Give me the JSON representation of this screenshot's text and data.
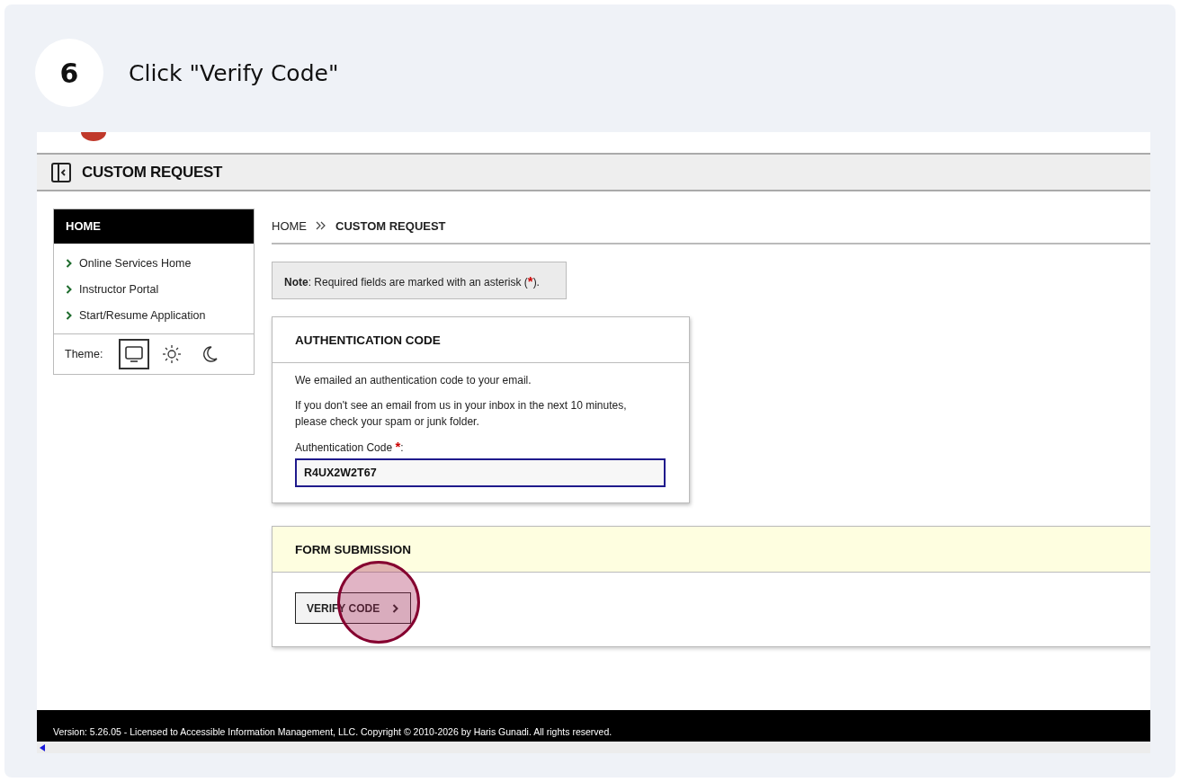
{
  "step": {
    "number": "6",
    "title": "Click \"Verify Code\""
  },
  "header": {
    "title": "CUSTOM REQUEST"
  },
  "sidebar": {
    "title": "HOME",
    "items": [
      {
        "label": "Online Services Home"
      },
      {
        "label": "Instructor Portal"
      },
      {
        "label": "Start/Resume Application"
      }
    ],
    "theme_label": "Theme:",
    "theme_options": [
      {
        "kind": "system",
        "selected": true
      },
      {
        "kind": "light",
        "selected": false
      },
      {
        "kind": "dark",
        "selected": false
      }
    ]
  },
  "breadcrumb": [
    {
      "label": "HOME",
      "current": false
    },
    {
      "label": "CUSTOM REQUEST",
      "current": true
    }
  ],
  "note": {
    "before": "**Note**: Required fields are marked with an asterisk (",
    "asterisk": "*",
    "after": ")."
  },
  "auth_card": {
    "title": "AUTHENTICATION CODE",
    "paragraphs": [
      "We emailed an authentication code to your email.",
      "If you don't see an email from us in your inbox in the next 10 minutes, please check your spam or junk folder."
    ],
    "field": {
      "label": "Authentication Code",
      "asterisk": "*",
      "colon": ":",
      "value": "R4UX2W2T67",
      "focused": true
    }
  },
  "form_submission": {
    "title": "FORM SUBMISSION",
    "button": "VERIFY CODE"
  },
  "footer": {
    "text": "Version: 5.26.05 - Licensed to Accessible Information Management, LLC. Copyright © 2010-2026 by Haris Gunadi. All rights reserved."
  }
}
